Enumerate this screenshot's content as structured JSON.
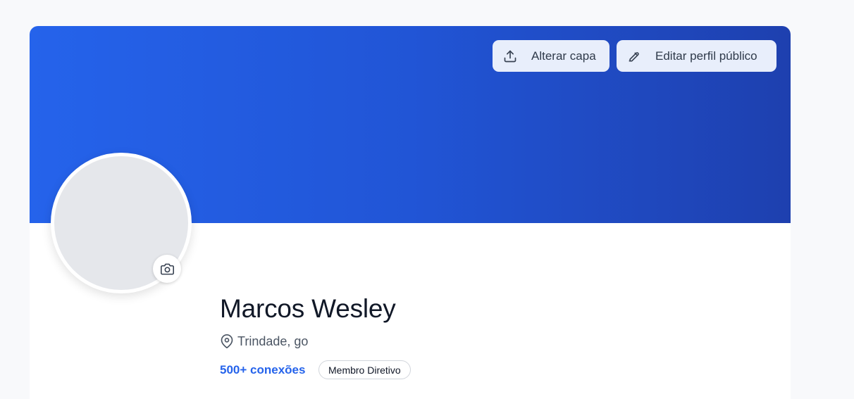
{
  "profile": {
    "name": "Marcos Wesley",
    "location": "Trindade, go",
    "connections": "500+ conexões",
    "badge": "Membro Diretivo"
  },
  "cover": {
    "change_cover_label": "Alterar capa",
    "edit_profile_label": "Editar perfil público"
  },
  "icons": {
    "upload": "upload-icon",
    "edit": "pencil-icon",
    "camera": "camera-icon",
    "location": "map-pin-icon"
  },
  "colors": {
    "cover_start": "#2563eb",
    "cover_end": "#1e40af",
    "accent": "#2563eb"
  }
}
